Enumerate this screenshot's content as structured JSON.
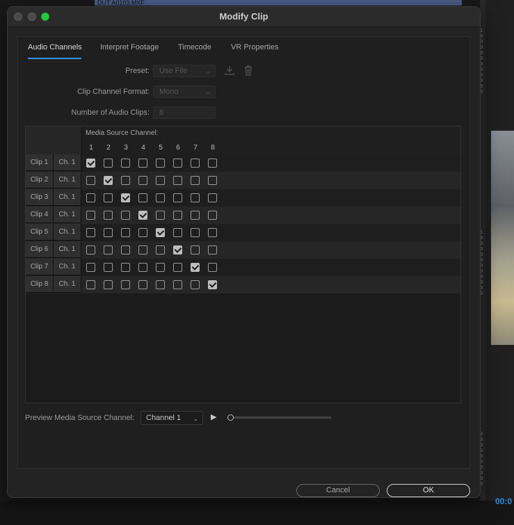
{
  "background": {
    "top_strip_text": "DUT A0103.MXF",
    "timecode_fragment": "00:0"
  },
  "dialog": {
    "title": "Modify Clip",
    "tabs": [
      {
        "label": "Audio Channels",
        "active": true
      },
      {
        "label": "Interpret Footage",
        "active": false
      },
      {
        "label": "Timecode",
        "active": false
      },
      {
        "label": "VR Properties",
        "active": false
      }
    ],
    "form": {
      "preset_label": "Preset:",
      "preset_value": "Use File",
      "format_label": "Clip Channel Format:",
      "format_value": "Mono",
      "count_label": "Number of Audio Clips:",
      "count_value": "8"
    },
    "grid": {
      "header_label": "Media Source Channel:",
      "channels": [
        "1",
        "2",
        "3",
        "4",
        "5",
        "6",
        "7",
        "8"
      ],
      "rows": [
        {
          "clip": "Clip 1",
          "ch": "Ch. 1",
          "checked": 1
        },
        {
          "clip": "Clip 2",
          "ch": "Ch. 1",
          "checked": 2
        },
        {
          "clip": "Clip 3",
          "ch": "Ch. 1",
          "checked": 3
        },
        {
          "clip": "Clip 4",
          "ch": "Ch. 1",
          "checked": 4
        },
        {
          "clip": "Clip 5",
          "ch": "Ch. 1",
          "checked": 5
        },
        {
          "clip": "Clip 6",
          "ch": "Ch. 1",
          "checked": 6
        },
        {
          "clip": "Clip 7",
          "ch": "Ch. 1",
          "checked": 7
        },
        {
          "clip": "Clip 8",
          "ch": "Ch. 1",
          "checked": 8
        }
      ]
    },
    "preview": {
      "label": "Preview Media Source Channel:",
      "selected": "Channel 1",
      "position": 0
    },
    "buttons": {
      "cancel": "Cancel",
      "ok": "OK"
    },
    "colors": {
      "accent": "#2d8ceb",
      "traffic_green": "#28c940"
    }
  }
}
